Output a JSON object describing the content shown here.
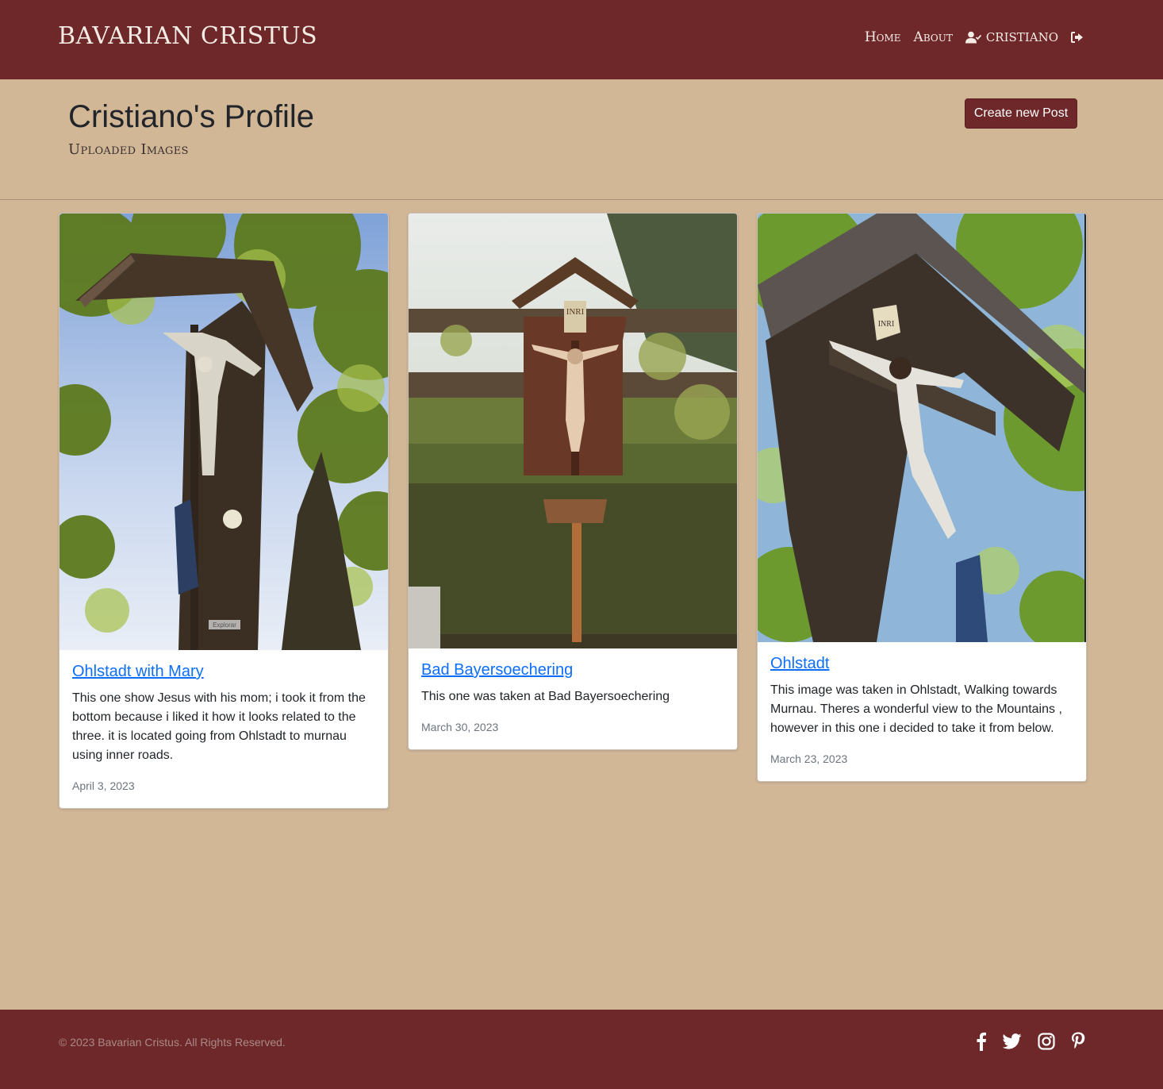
{
  "header": {
    "brand": "Bavarian Cristus",
    "nav": {
      "home": "Home",
      "about": "About",
      "user": "CRISTIANO"
    }
  },
  "profile": {
    "title": "Cristiano's Profile",
    "subtitle": "Uploaded Images",
    "create_button": "Create new Post"
  },
  "posts": [
    {
      "title": "Ohlstadt with Mary",
      "text": "This one show Jesus with his mom; i took it from the bottom because i liked it how it looks related to the three. it is located going from Ohlstadt to murnau using inner roads.",
      "date": "April 3, 2023",
      "image_overlay": "Explorar"
    },
    {
      "title": "Bad Bayersoechering",
      "text": "This one was taken at Bad Bayersoechering",
      "date": "March 30, 2023",
      "image_overlay": "INRI"
    },
    {
      "title": "Ohlstadt",
      "text": "This image was taken in Ohlstadt, Walking towards Murnau. Theres a wonderful view to the Mountains , however in this one i decided to take it from below.",
      "date": "March 23, 2023",
      "image_overlay": "INRI"
    }
  ],
  "footer": {
    "copyright": "© 2023 Bavarian Cristus. All Rights Reserved.",
    "social_icons": [
      "facebook-icon",
      "twitter-icon",
      "instagram-icon",
      "pinterest-icon"
    ]
  },
  "colors": {
    "primary": "#6e282a",
    "background": "#d2b797",
    "link": "#0d6efd"
  }
}
